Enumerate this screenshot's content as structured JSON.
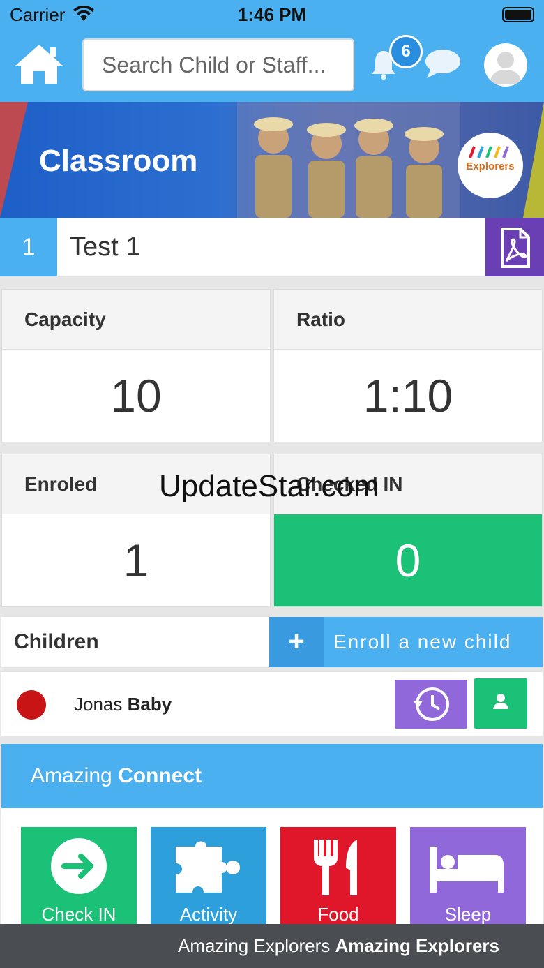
{
  "status_bar": {
    "carrier": "Carrier",
    "time": "1:46 PM"
  },
  "header": {
    "search_placeholder": "Search Child or Staff...",
    "notification_count": "6",
    "icons": [
      "home-icon",
      "bell-icon",
      "chat-icon",
      "avatar-icon"
    ]
  },
  "banner": {
    "title": "Classroom",
    "logo_text": "Explorers"
  },
  "classroom": {
    "number": "1",
    "name": "Test 1"
  },
  "stats": {
    "capacity_label": "Capacity",
    "capacity_value": "10",
    "ratio_label": "Ratio",
    "ratio_value": "1:10",
    "enroled_label": "Enroled",
    "enroled_value": "1",
    "checked_in_label": "Checked IN",
    "checked_in_value": "0"
  },
  "children": {
    "title": "Children",
    "enroll_plus": "+",
    "enroll_label": "Enroll a new child",
    "list": [
      {
        "first_name": "Jonas",
        "last_name": "Baby",
        "status_color": "#c81414"
      }
    ]
  },
  "connect": {
    "prefix": "Amazing",
    "title": "Connect",
    "tiles": [
      {
        "label": "Check IN",
        "color": "#1bc177",
        "icon": "arrow-right-icon"
      },
      {
        "label": "Activity",
        "color": "#2da0dc",
        "icon": "puzzle-icon"
      },
      {
        "label": "Food",
        "color": "#e0162a",
        "icon": "fork-knife-icon"
      },
      {
        "label": "Sleep",
        "color": "#9068da",
        "icon": "bed-icon"
      }
    ]
  },
  "footer": {
    "left": "Amazing Explorers",
    "right": "Amazing Explorers"
  },
  "watermark": "UpdateStar.com",
  "colors": {
    "primary": "#4ab0f0",
    "green": "#1bc177",
    "purple": "#6a3fb3",
    "footer": "#4a4d52"
  }
}
